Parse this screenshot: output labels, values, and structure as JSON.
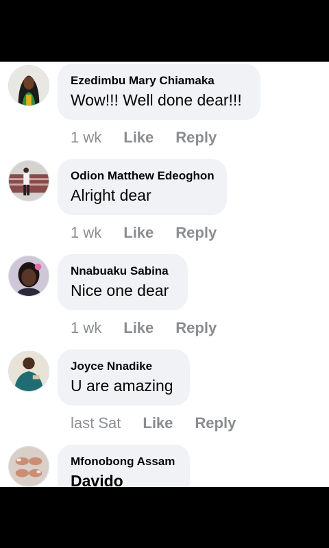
{
  "comments": [
    {
      "name": "Ezedimbu Mary Chiamaka",
      "text": "Wow!!! Well done dear!!!",
      "time": "1 wk",
      "like": "Like",
      "reply": "Reply"
    },
    {
      "name": "Odion Matthew Edeoghon",
      "text": "Alright dear",
      "time": "1 wk",
      "like": "Like",
      "reply": "Reply"
    },
    {
      "name": "Nnabuaku Sabina",
      "text": "Nice one dear",
      "time": "1 wk",
      "like": "Like",
      "reply": "Reply"
    },
    {
      "name": "Joyce Nnadike",
      "text": "U are amazing",
      "time": "last Sat",
      "like": "Like",
      "reply": "Reply"
    },
    {
      "name": "Mfonobong Assam",
      "text": "Davido"
    }
  ],
  "colors": {
    "bubble": "#f0f2f5",
    "meta": "#8a8d91",
    "text": "#050505"
  }
}
